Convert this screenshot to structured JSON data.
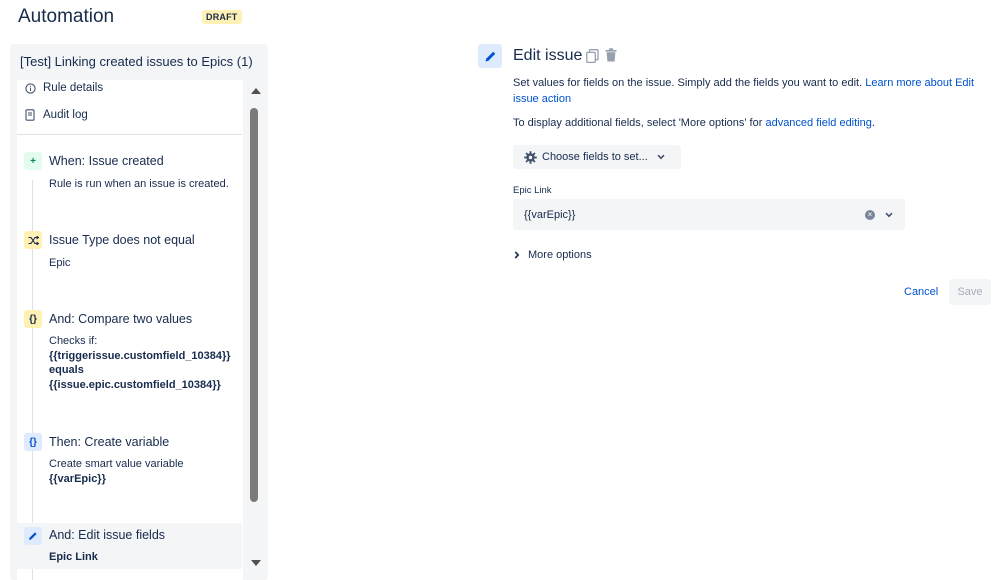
{
  "header": {
    "title": "Automation",
    "badge": "DRAFT"
  },
  "rule": {
    "name": "[Test] Linking created issues to Epics (1)",
    "menu": [
      {
        "label": "Rule details",
        "icon": "info-icon"
      },
      {
        "label": "Audit log",
        "icon": "document-icon"
      }
    ],
    "steps": [
      {
        "title": "When: Issue created",
        "desc": "Rule is run when an issue is created.",
        "icon": "plus-icon"
      },
      {
        "title": "Issue Type does not equal",
        "desc": "Epic",
        "icon": "shuffle-icon"
      },
      {
        "title": "And: Compare two values",
        "desc_prefix": "Checks if:",
        "desc_lines": [
          "{{triggerissue.customfield_10384}}",
          "equals",
          "{{issue.epic.customfield_10384}}"
        ],
        "icon": "braces-icon"
      },
      {
        "title": "Then: Create variable",
        "desc": "Create smart value variable",
        "desc_bold": "{{varEpic}}",
        "icon": "braces-icon"
      },
      {
        "title": "And: Edit issue fields",
        "desc_bold": "Epic Link",
        "icon": "pencil-icon"
      }
    ]
  },
  "editor": {
    "title": "Edit issue",
    "description": "Set values for fields on the issue. Simply add the fields you want to edit.",
    "learn_more": "Learn more about Edit issue action",
    "additional_prefix": "To display additional fields, select 'More options' for",
    "additional_link": "advanced field editing",
    "additional_suffix": ".",
    "choose_fields": "Choose fields to set...",
    "field_label": "Epic Link",
    "field_value": "{{varEpic}}",
    "more_options": "More options",
    "cancel": "Cancel",
    "save": "Save"
  },
  "colors": {
    "accent": "#0052cc",
    "panel_bg": "#f4f5f7",
    "draft_badge": "#fff0b3"
  }
}
